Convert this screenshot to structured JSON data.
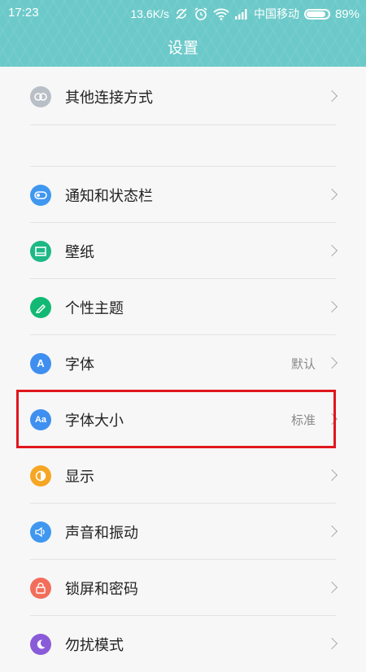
{
  "status_bar": {
    "time": "17:23",
    "network_speed": "13.6K/s",
    "carrier": "中国移动",
    "battery": "89%",
    "battery_level": 0.89
  },
  "header": {
    "title": "设置"
  },
  "settings": {
    "other_connections": {
      "label": "其他连接方式",
      "icon": "link-icon",
      "color": "#b9bfc6"
    },
    "notifications": {
      "label": "通知和状态栏",
      "icon": "toggle-icon",
      "color": "#3f97f0"
    },
    "wallpaper": {
      "label": "壁纸",
      "icon": "image-icon",
      "color": "#1db885"
    },
    "themes": {
      "label": "个性主题",
      "icon": "brush-icon",
      "color": "#12b974"
    },
    "font": {
      "label": "字体",
      "value": "默认",
      "icon": "font-icon",
      "color": "#3f8ff0"
    },
    "font_size": {
      "label": "字体大小",
      "value": "标准",
      "icon": "font-size-icon",
      "color": "#3f8ff0"
    },
    "display": {
      "label": "显示",
      "icon": "brightness-icon",
      "color": "#f5a623"
    },
    "sound": {
      "label": "声音和振动",
      "icon": "speaker-icon",
      "color": "#3f97f0"
    },
    "lock_screen": {
      "label": "锁屏和密码",
      "icon": "lock-icon",
      "color": "#f26e5a"
    },
    "dnd": {
      "label": "勿扰模式",
      "icon": "moon-icon",
      "color": "#8a5bd9"
    }
  },
  "highlight_color": "#e0171d"
}
